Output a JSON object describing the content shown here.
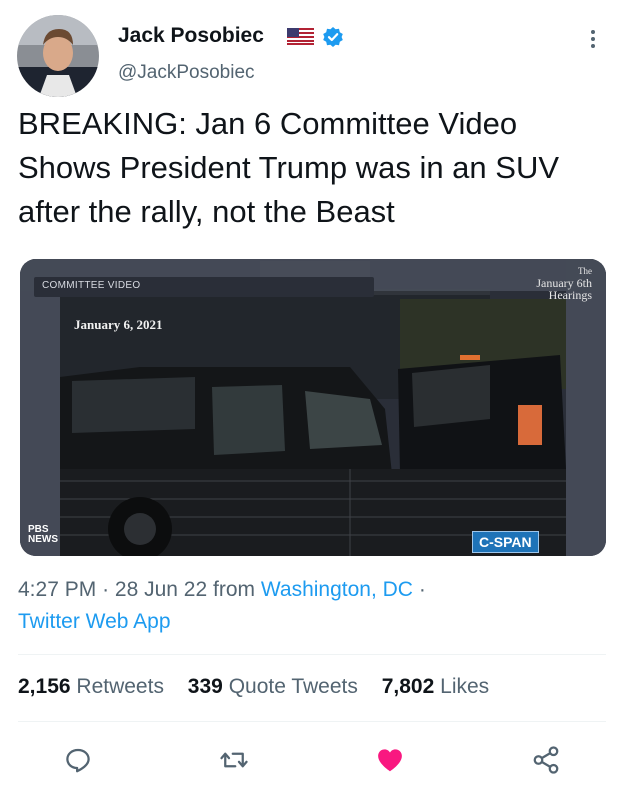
{
  "author": {
    "name": "Jack Posobiec",
    "handle": "@JackPosobiec",
    "flag": "us-flag-icon",
    "verified_icon": "verified-badge-icon"
  },
  "tweet": {
    "text": "BREAKING: Jan 6 Committee Video Shows President Trump was in an SUV after the rally, not the Beast"
  },
  "media": {
    "banner_label": "COMMITTEE VIDEO",
    "date_overlay": "January 6, 2021",
    "watermark_top": "The",
    "watermark_mid": "January 6th",
    "watermark_bottom": "Hearings",
    "pbs_logo_line1": "PBS",
    "pbs_logo_line2": "NEWS",
    "cspan_logo": "C-SPAN"
  },
  "meta": {
    "time": "4:27 PM",
    "date": "28 Jun 22",
    "from_label": "from",
    "location": "Washington, DC",
    "separator": "·",
    "source": "Twitter Web App"
  },
  "stats": {
    "retweets_count": "2,156",
    "retweets_label": "Retweets",
    "quotes_count": "339",
    "quotes_label": "Quote Tweets",
    "likes_count": "7,802",
    "likes_label": "Likes"
  },
  "actions": {
    "reply_icon": "reply-icon",
    "retweet_icon": "retweet-icon",
    "like_icon": "heart-icon",
    "share_icon": "share-icon"
  },
  "colors": {
    "accent": "#1d9bf0",
    "like": "#f91880",
    "text": "#0f1419",
    "secondary": "#536471"
  }
}
